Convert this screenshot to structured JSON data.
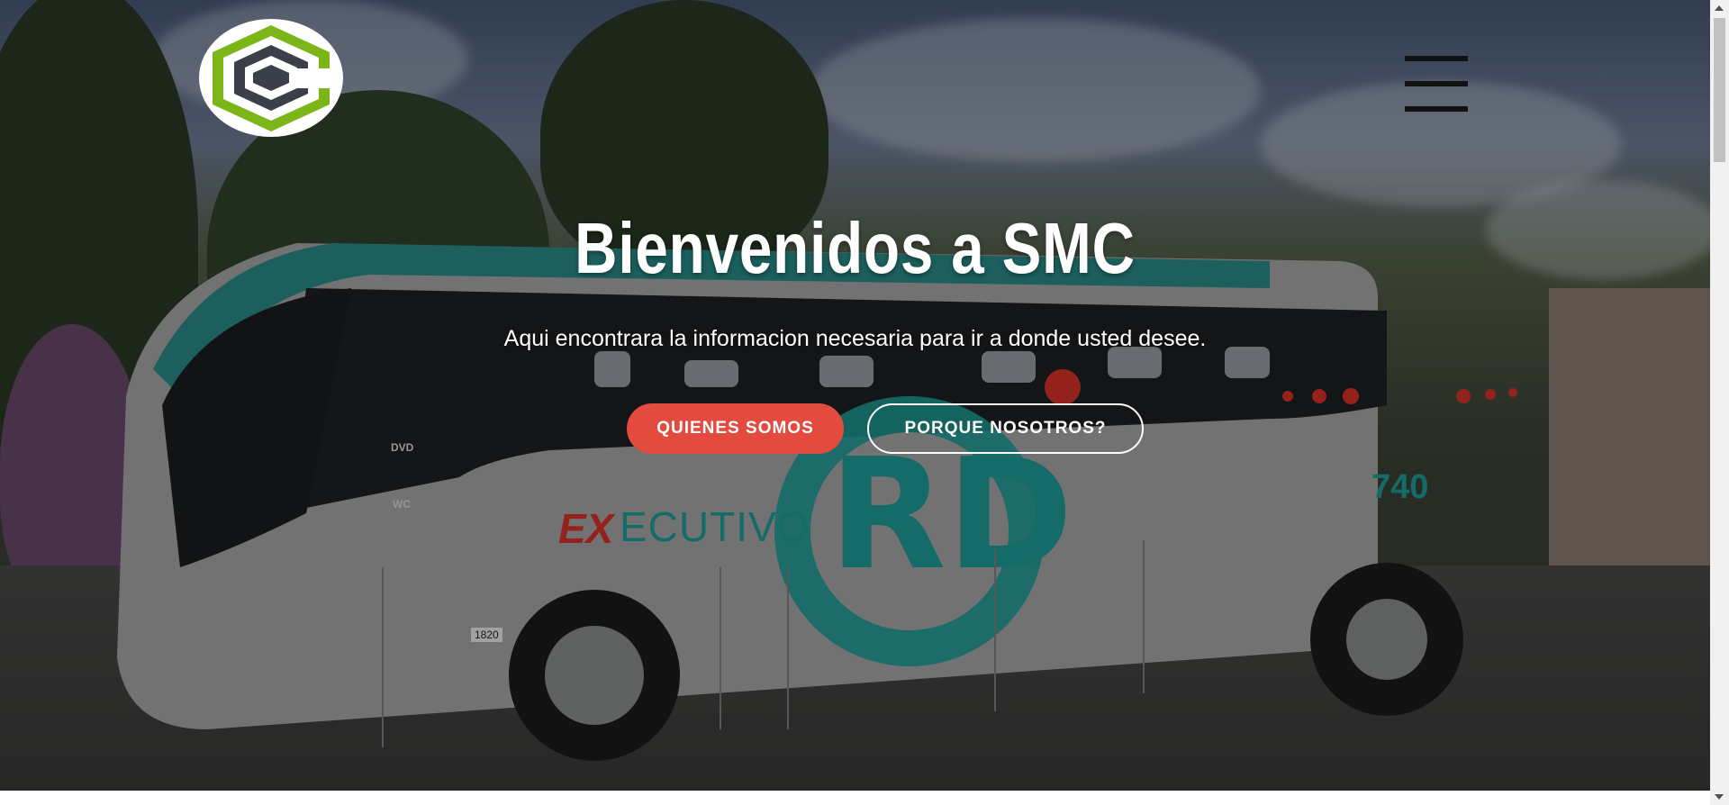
{
  "hero": {
    "title": "Bienvenidos a SMC",
    "subtitle": "Aqui encontrara la informacion necesaria para ir a donde usted desee.",
    "primary_button": "QUIENES SOMOS",
    "secondary_button": "PORQUE NOSOTROS?"
  },
  "bus": {
    "brand_ex": "EX",
    "brand_rest": "ECUTIVO",
    "number": "740",
    "plate": "1820",
    "feature_dvd": "DVD",
    "feature_wc": "WC"
  },
  "logo": {
    "name": "smc-logo-icon"
  },
  "menu": {
    "icon": "hamburger-menu-icon"
  },
  "colors": {
    "primary_button": "#e24b3e",
    "logo_green": "#7cb518",
    "logo_dark": "#3a3f4a",
    "bus_teal": "#1f9e99"
  }
}
